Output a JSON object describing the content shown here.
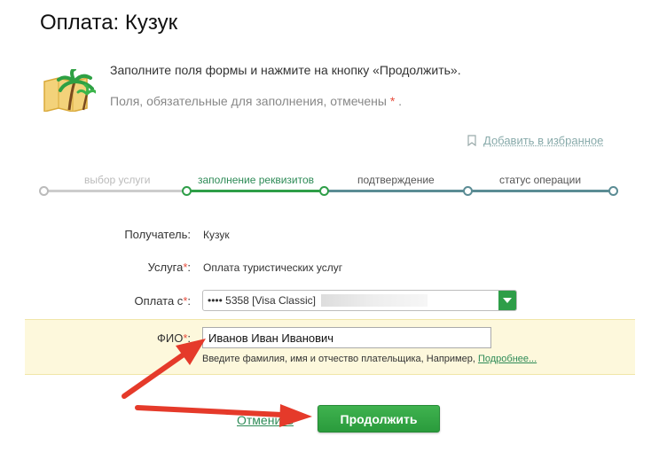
{
  "page": {
    "title": "Оплата: Кузук"
  },
  "intro": {
    "instruction": "Заполните поля формы и нажмите на кнопку «Продолжить».",
    "required_note": "Поля, обязательные для заполнения, отмечены",
    "required_star": "*",
    "required_end": "."
  },
  "favorites": {
    "label": "Добавить в избранное",
    "icon": "bookmark-icon"
  },
  "steps": [
    {
      "label": "выбор услуги",
      "state": "done"
    },
    {
      "label": "заполнение реквизитов",
      "state": "active"
    },
    {
      "label": "подтверждение",
      "state": "pending"
    },
    {
      "label": "статус операции",
      "state": "pending"
    }
  ],
  "form": {
    "recipient": {
      "label": "Получатель:",
      "value": "Кузук"
    },
    "service": {
      "label": "Услуга",
      "required": "*",
      "colon": ":",
      "value": "Оплата туристических услуг"
    },
    "pay_from": {
      "label": "Оплата с",
      "required": "*",
      "colon": ":",
      "value": "•••• 5358 [Visa Classic]"
    },
    "fio": {
      "label": "ФИО",
      "required": "*",
      "colon": ":",
      "value": "Иванов Иван Иванович",
      "hint": "Введите фамилия, имя и отчество плательщика, Например,",
      "hint_link": "Подробнее..."
    }
  },
  "actions": {
    "cancel": "Отменить",
    "continue": "Продолжить"
  },
  "colors": {
    "brand_green": "#2e9e48",
    "arrow_red": "#e53a2a",
    "highlight": "#fdf8dc"
  }
}
